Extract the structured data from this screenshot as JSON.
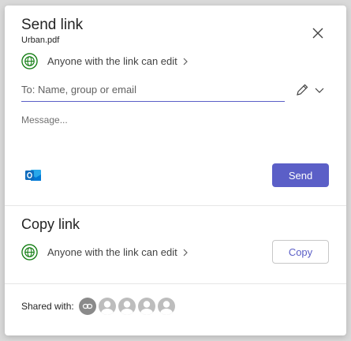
{
  "send_link": {
    "title": "Send link",
    "filename": "Urban.pdf",
    "permission": "Anyone with the link can edit",
    "to_placeholder": "To: Name, group or email",
    "message_placeholder": "Message...",
    "send_label": "Send",
    "icons": {
      "globe": "globe-icon",
      "close": "close-icon",
      "pencil": "pencil-icon",
      "dropdown": "chevron-down-icon",
      "outlook": "outlook-icon"
    }
  },
  "copy_link": {
    "title": "Copy link",
    "permission": "Anyone with the link can edit",
    "copy_label": "Copy"
  },
  "shared_with": {
    "label": "Shared with:",
    "avatars": [
      "link-avatar",
      "person-avatar",
      "person-avatar",
      "person-avatar",
      "person-avatar"
    ]
  },
  "colors": {
    "accent": "#5b5fc7",
    "globe_green": "#107c10",
    "outlook_blue": "#0f6cbd"
  }
}
